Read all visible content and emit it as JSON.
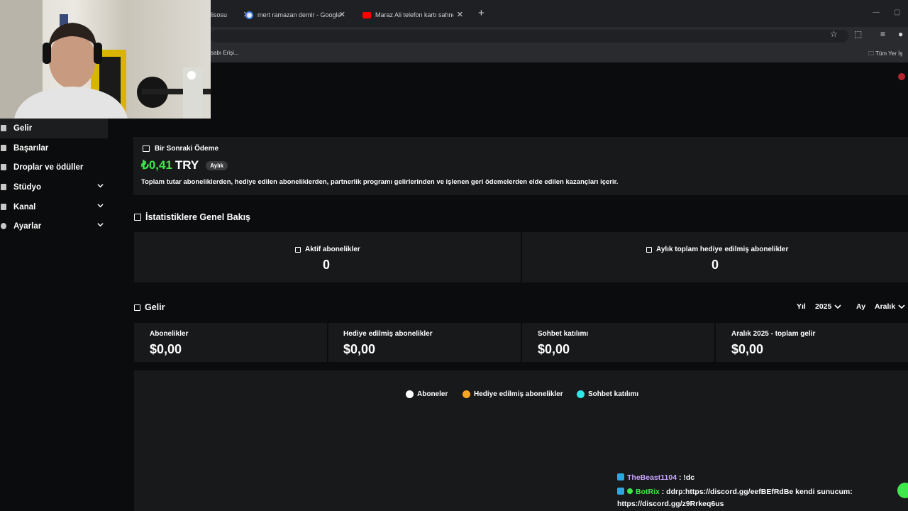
{
  "browser": {
    "tabs": [
      {
        "title": "lisosu",
        "favicon_color": "#5b6ee1"
      },
      {
        "title": "mert ramazan demir - Google'da",
        "favicon_color": "#e8eaed"
      },
      {
        "title": "Maraz Ali telefon kartı sahnesi",
        "favicon_color": "#ff0000"
      }
    ],
    "new_tab": "+",
    "bookmark_left": "sabı Erişi...",
    "bookmark_right": "Tüm Yer İş"
  },
  "sidebar": {
    "items": [
      {
        "label": "Gelir"
      },
      {
        "label": "Başarılar"
      },
      {
        "label": "Droplar ve ödüller"
      },
      {
        "label": "Stüdyo"
      },
      {
        "label": "Kanal"
      },
      {
        "label": "Ayarlar"
      }
    ]
  },
  "payout": {
    "heading": "Bir Sonraki Ödeme",
    "amount": "₺0,41",
    "currency": "TRY",
    "period_badge": "Aylık",
    "description": "Toplam tutar aboneliklerden, hediye edilen aboneliklerden, partnerlik programı gelirlerinden ve işlenen geri ödemelerden elde edilen kazançları içerir.",
    "amount_color": "#3fe84a"
  },
  "stats": {
    "heading": "İstatistiklere Genel Bakış",
    "active_label": "Aktif abonelikler",
    "active_value": "0",
    "gifted_label": "Aylık toplam hediye edilmiş abonelikler",
    "gifted_value": "0"
  },
  "revenue": {
    "heading": "Gelir",
    "year_label": "Yıl",
    "year_value": "2025",
    "month_label": "Ay",
    "month_value": "Aralık",
    "cards": [
      {
        "label": "Abonelikler",
        "value": "$0,00"
      },
      {
        "label": "Hediye edilmiş abonelikler",
        "value": "$0,00"
      },
      {
        "label": "Sohbet katılımı",
        "value": "$0,00"
      },
      {
        "label": "Aralık 2025 - toplam gelir",
        "value": "$0,00"
      }
    ],
    "legend": [
      {
        "label": "Aboneler",
        "color": "#ffffff"
      },
      {
        "label": "Hediye edilmiş abonelikler",
        "color": "#f5a623"
      },
      {
        "label": "Sohbet katılımı",
        "color": "#2ee6e6"
      }
    ]
  },
  "chat": {
    "messages": [
      {
        "user": "TheBeast1104",
        "user_color": "#c9a6ff",
        "text": ": !dc"
      },
      {
        "user": "BotRix",
        "user_color": "#3fe84a",
        "text": ": ddrp:https://discord.gg/eefBEfRdBe kendi sunucum:"
      }
    ],
    "continuation": "https://discord.gg/z9Rrkeq6us"
  }
}
